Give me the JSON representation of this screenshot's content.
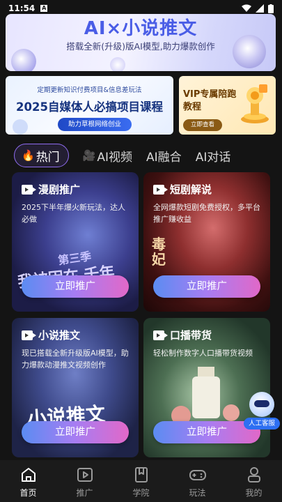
{
  "status_bar": {
    "time": "11:54",
    "notify_glyph": "A"
  },
  "hero": {
    "title": "AI×小说推文",
    "subtitle": "搭载全新(升级)版AI模型,助力爆款创作"
  },
  "promo_main": {
    "top_text": "定期更新知识付费项目&信息差玩法",
    "title": "2025自媒体人必搞项目课程",
    "button": "助力草根网络创业"
  },
  "promo_vip": {
    "title": "VIP专属陪跑教程",
    "button": "立即查看"
  },
  "tabs": [
    {
      "label": "热门",
      "icon": "fire-icon",
      "glyph": "🔥"
    },
    {
      "label": "AI视频",
      "icon": "video-camera-icon",
      "glyph": "🎥"
    },
    {
      "label": "AI融合",
      "icon": "",
      "glyph": ""
    },
    {
      "label": "AI对话",
      "icon": "",
      "glyph": ""
    }
  ],
  "cards": [
    {
      "title": "漫剧推广",
      "desc": "2025下半年爆火新玩法，达人必做",
      "cta": "立即推广",
      "art_text": "我被困在 千年",
      "art_badge": "第三季"
    },
    {
      "title": "短剧解说",
      "desc": "全网爆款短剧免费授权，多平台推广赚收益",
      "cta": "立即推广",
      "art_text": "毒妃",
      "art_badge": ""
    },
    {
      "title": "小说推文",
      "desc": "现已搭载全新升级版AI模型，助力爆款动漫推文视频创作",
      "cta": "立即推广",
      "art_text": "小说推文",
      "art_badge": ""
    },
    {
      "title": "口播带货",
      "desc": "轻松制作数字人口播带货视频",
      "cta": "立即推广",
      "art_text": "",
      "art_badge": ""
    }
  ],
  "customer_service": {
    "label": "人工客服"
  },
  "bottom_nav": [
    {
      "label": "首页",
      "icon": "home-icon",
      "active": true
    },
    {
      "label": "推广",
      "icon": "play-icon",
      "active": false
    },
    {
      "label": "学院",
      "icon": "bookmark-icon",
      "active": false
    },
    {
      "label": "玩法",
      "icon": "gamepad-icon",
      "active": false
    },
    {
      "label": "我的",
      "icon": "user-icon",
      "active": false
    }
  ],
  "colors": {
    "accent": "#8f6cf0",
    "cta_start": "#5b8cf2",
    "cta_end": "#e168c8",
    "background": "#141414"
  }
}
